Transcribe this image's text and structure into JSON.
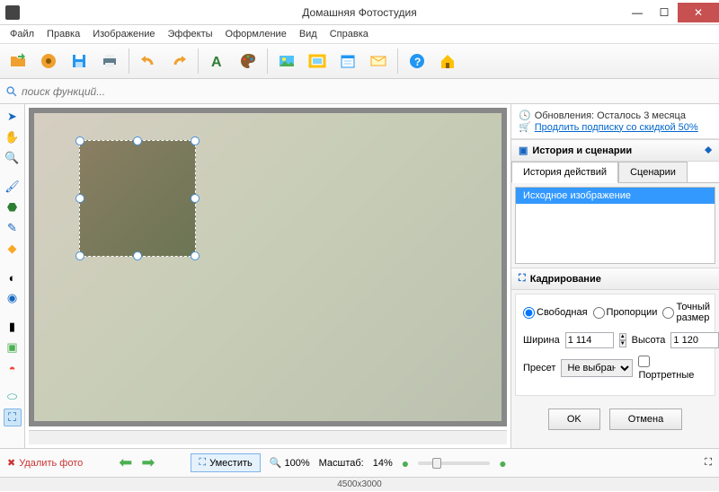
{
  "app": {
    "title": "Домашняя Фотостудия"
  },
  "menu": [
    "Файл",
    "Правка",
    "Изображение",
    "Эффекты",
    "Оформление",
    "Вид",
    "Справка"
  ],
  "search": {
    "placeholder": "поиск функций..."
  },
  "update": {
    "line1": "Обновления: Осталось  3 месяца",
    "line2": "Продлить подписку со скидкой 50%"
  },
  "history_panel": {
    "title": "История и сценарии",
    "tabs": {
      "history": "История действий",
      "scenarios": "Сценарии"
    },
    "item": "Исходное изображение"
  },
  "crop_panel": {
    "title": "Кадрирование",
    "modes": {
      "free": "Свободная",
      "prop": "Пропорции",
      "exact": "Точный размер"
    },
    "width_label": "Ширина",
    "width_value": "1 114",
    "height_label": "Высота",
    "height_value": "1 120",
    "preset_label": "Пресет",
    "preset_value": "Не выбрано",
    "portrait": "Портретные",
    "ok": "OK",
    "cancel": "Отмена"
  },
  "bottom": {
    "delete": "Удалить фото",
    "fit": "Уместить",
    "zoom100": "100%",
    "scale_label": "Масштаб:",
    "scale_value": "14%"
  },
  "status": {
    "dims": "4500x3000"
  }
}
